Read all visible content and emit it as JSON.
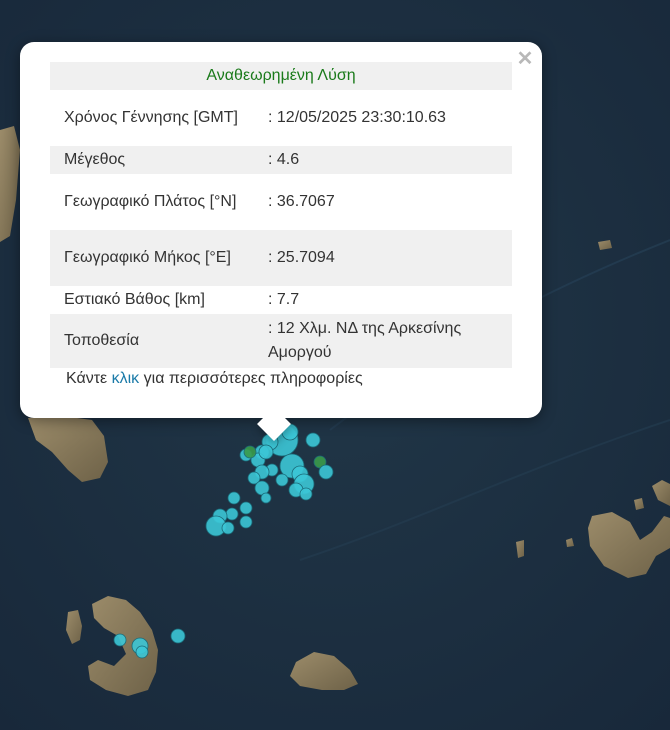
{
  "popup": {
    "title": "Αναθεωρημένη Λύση",
    "close_glyph": "✕",
    "rows": [
      {
        "label": "Χρόνος Γέννησης [GMT]",
        "value": ": 12/05/2025 23:30:10.63"
      },
      {
        "label": "Μέγεθος",
        "value": ": 4.6"
      },
      {
        "label": "Γεωγραφικό Πλάτος [°N]",
        "value": ": 36.7067"
      },
      {
        "label": "Γεωγραφικό Μήκος [°E]",
        "value": ": 25.7094"
      },
      {
        "label": "Εστιακό Βάθος [km]",
        "value": ": 7.7"
      },
      {
        "label": "Τοποθεσία",
        "value": ": 12 Χλμ. ΝΔ της Αρκεσίνης Αμοργού"
      }
    ],
    "more_prefix": "Κάντε ",
    "more_link": "κλικ",
    "more_suffix": " για περισσότερες πληροφορίες"
  },
  "colors": {
    "sea": "#1d3040",
    "land": "#8a7a5c",
    "quake_marker": "#3cc6d6",
    "quake_marker_revised": "#3a9a4a",
    "title_green": "#1a7a1a",
    "link_blue": "#1a7aa8"
  }
}
